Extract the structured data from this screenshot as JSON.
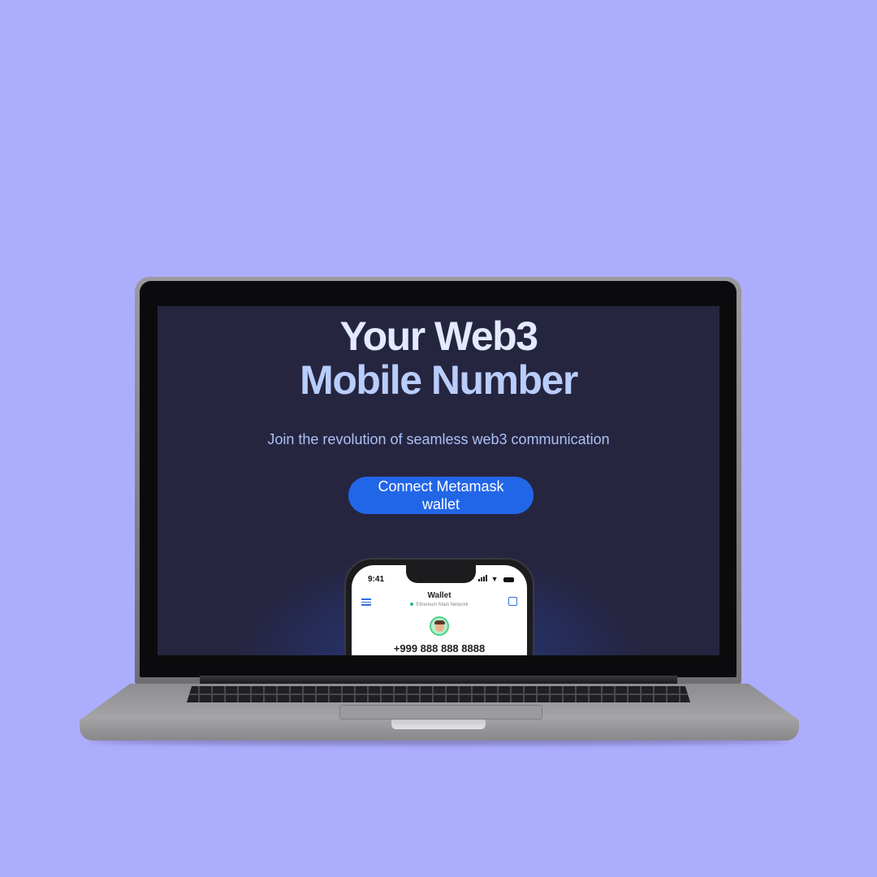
{
  "hero": {
    "headline_line1": "Your Web3",
    "headline_line2": "Mobile Number",
    "subtitle": "Join the revolution of seamless web3 communication",
    "cta_label": "Connect Metamask wallet"
  },
  "phone": {
    "status_time": "9:41",
    "title": "Wallet",
    "network": "Ethereum Main Network",
    "number": "+999 888 888 8888",
    "icons": [
      "menu-icon",
      "scan-icon",
      "avatar",
      "signal-icon",
      "wifi-icon",
      "battery-icon"
    ]
  },
  "colors": {
    "background": "#adadfe",
    "screen": "#262540",
    "button": "#2266e8",
    "headline": "#c8d6ff",
    "network_dot": "#2eb872"
  }
}
